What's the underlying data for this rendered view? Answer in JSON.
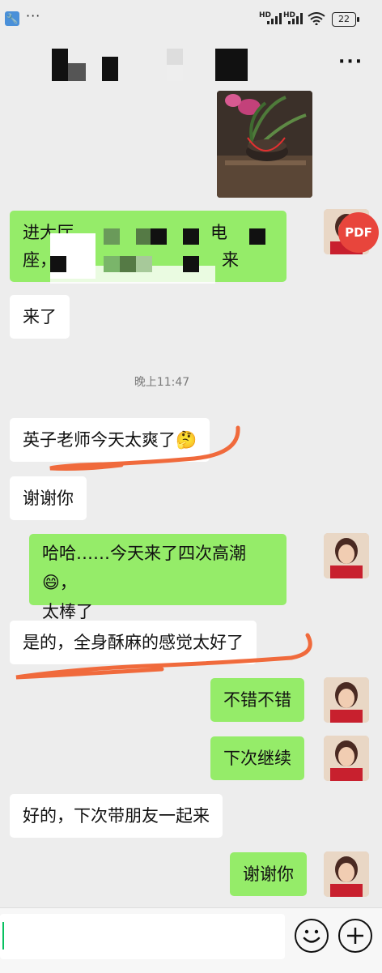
{
  "status_bar": {
    "battery": "22",
    "hd1": "HD",
    "hd2": "HD",
    "more": "···"
  },
  "header": {
    "more_icon": "···"
  },
  "messages": {
    "m1_text": "进大厅\n座，",
    "m1_a": "电",
    "m1_b": "来",
    "m2": "来了",
    "time": "晚上11:47",
    "m3": "英子老师今天太爽了🤔",
    "m4": "谢谢你",
    "m5": "哈哈……今天来了四次高潮😄，\n太棒了",
    "m6": "是的，全身酥麻的感觉太好了",
    "m7": "不错不错",
    "m8": "下次继续",
    "m9": "好的，下次带朋友一起来",
    "m10": "谢谢你"
  },
  "pdf_badge": "PDF",
  "colors": {
    "background": "#ededed",
    "sent_bubble": "#95ec69",
    "received_bubble": "#ffffff",
    "annotation": "#f06a3c",
    "pdf": "#e8453c"
  }
}
